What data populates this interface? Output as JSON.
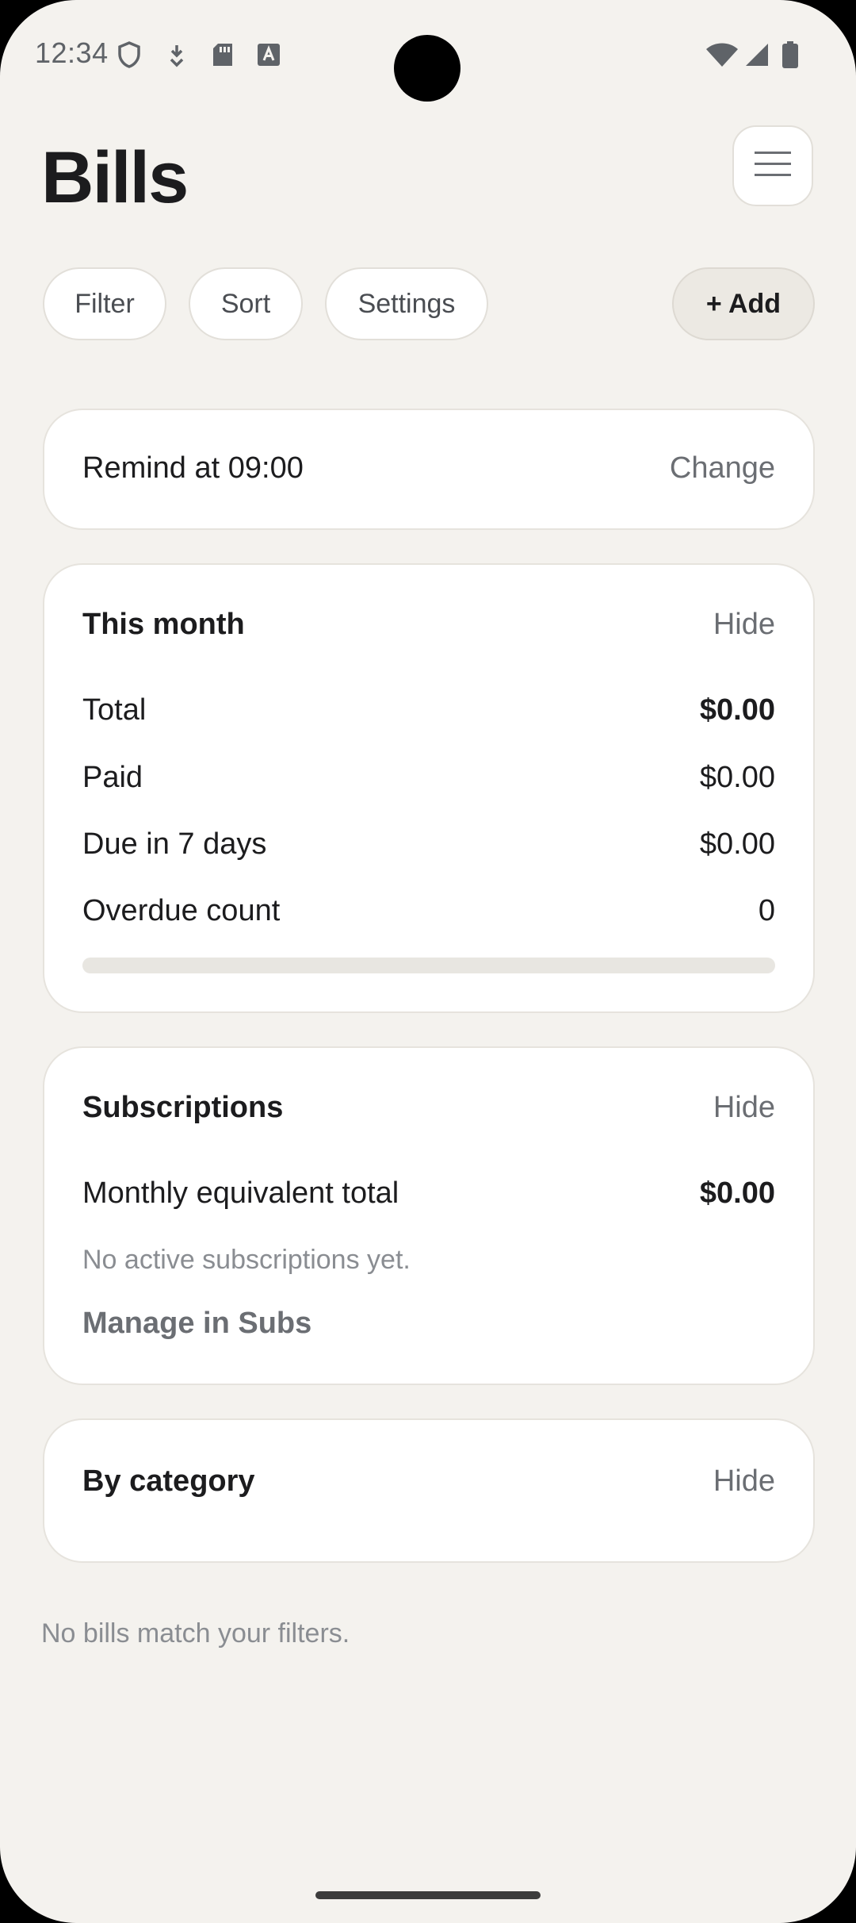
{
  "status_bar": {
    "time": "12:34",
    "icons": [
      "shield-icon",
      "download-icon",
      "sd-card-icon",
      "text-a-icon"
    ],
    "right_icons": [
      "wifi-icon",
      "signal-icon",
      "battery-icon"
    ]
  },
  "header": {
    "title": "Bills",
    "menu_icon": "hamburger-menu-icon"
  },
  "toolbar": {
    "filter_label": "Filter",
    "sort_label": "Sort",
    "settings_label": "Settings",
    "add_label": "+ Add"
  },
  "reminder": {
    "label": "Remind at 09:00",
    "action": "Change"
  },
  "this_month": {
    "title": "This month",
    "hide_label": "Hide",
    "rows": [
      {
        "label": "Total",
        "value": "$0.00"
      },
      {
        "label": "Paid",
        "value": "$0.00"
      },
      {
        "label": "Due in 7 days",
        "value": "$0.00"
      },
      {
        "label": "Overdue count",
        "value": "0"
      }
    ],
    "progress": 0
  },
  "subscriptions": {
    "title": "Subscriptions",
    "hide_label": "Hide",
    "total_label": "Monthly equivalent total",
    "total_value": "$0.00",
    "empty_text": "No active subscriptions yet.",
    "manage_link": "Manage in Subs"
  },
  "by_category": {
    "title": "By category",
    "hide_label": "Hide"
  },
  "empty_state": "No bills match your filters.",
  "colors": {
    "background": "#F4F2EE",
    "card": "#FFFFFF",
    "text": "#1C1C1E",
    "muted": "#8A8D92"
  }
}
